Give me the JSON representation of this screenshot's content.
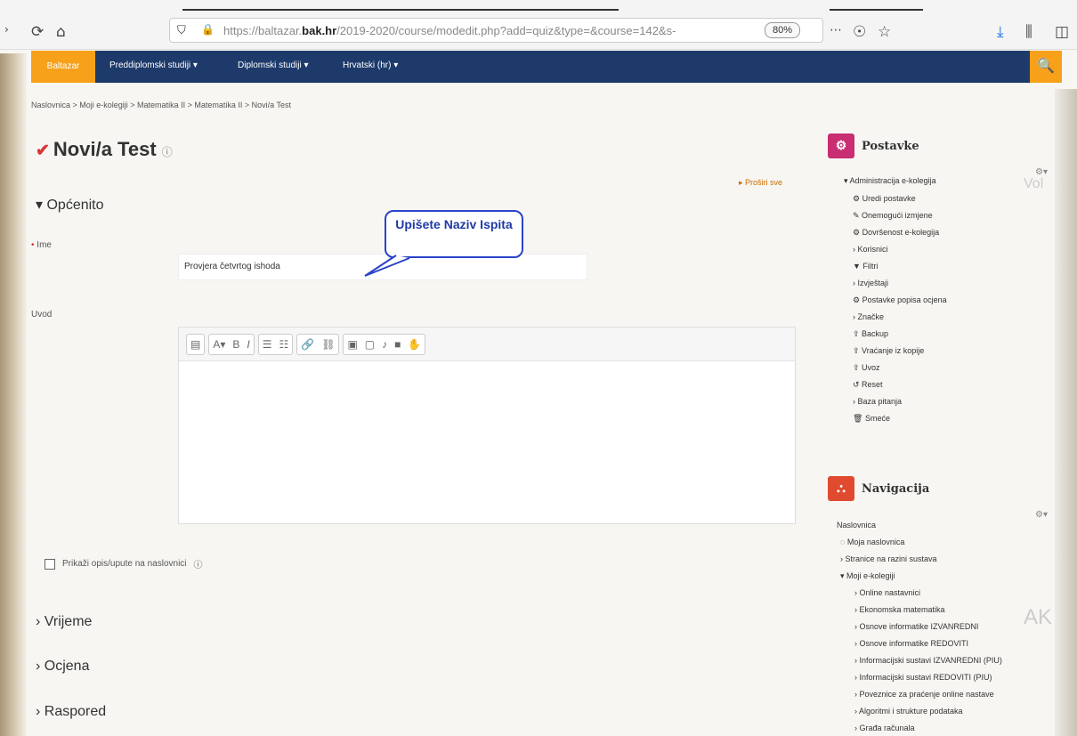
{
  "browser": {
    "url_pre": "https://baltazar.",
    "url_domain": "bak.hr",
    "url_post": "/2019-2020/course/modedit.php?add=quiz&type=&course=142&s-",
    "zoom": "80%"
  },
  "nav": {
    "brand": "Baltazar",
    "items": [
      "Preddiplomski studiji ▾",
      "Diplomski studiji ▾",
      "Hrvatski (hr) ▾"
    ]
  },
  "breadcrumb": "Naslovnica > Moji e-kolegiji > Matematika II > Matematika II > Novi/a Test",
  "page": {
    "title": "Novi/a Test",
    "expand_all": "▸ Proširi sve",
    "general": "Općenito",
    "name_label": "Ime",
    "name_value": "Provjera četvrtog ishoda",
    "intro_label": "Uvod",
    "show_desc": "Prikaži opis/upute na naslovnici",
    "sections": [
      "Vrijeme",
      "Ocjena",
      "Raspored"
    ]
  },
  "callout": {
    "text": "Upišete Naziv Ispita"
  },
  "settings": {
    "title": "Postavke",
    "items": [
      "Administracija e-kolegija",
      "Uredi postavke",
      "Onemogući izmjene",
      "Dovršenost e-kolegija",
      "Korisnici",
      "Filtri",
      "Izvještaji",
      "Postavke popisa ocjena",
      "Značke",
      "Backup",
      "Vraćanje iz kopije",
      "Uvoz",
      "Reset",
      "Baza pitanja",
      "Smeće"
    ]
  },
  "navigation": {
    "title": "Navigacija",
    "items": [
      "Naslovnica",
      "Moja naslovnica",
      "Stranice na razini sustava",
      "Moji e-kolegiji",
      "Online nastavnici",
      "Ekonomska matematika",
      "Osnove informatike IZVANREDNI",
      "Osnove informatike REDOVITI",
      "Informacijski sustavi IZVANREDNI (PIU)",
      "Informacijski sustavi REDOVITI (PIU)",
      "Poveznice za praćenje online nastave",
      "Algoritmi i strukture podataka",
      "Građa računala"
    ]
  }
}
